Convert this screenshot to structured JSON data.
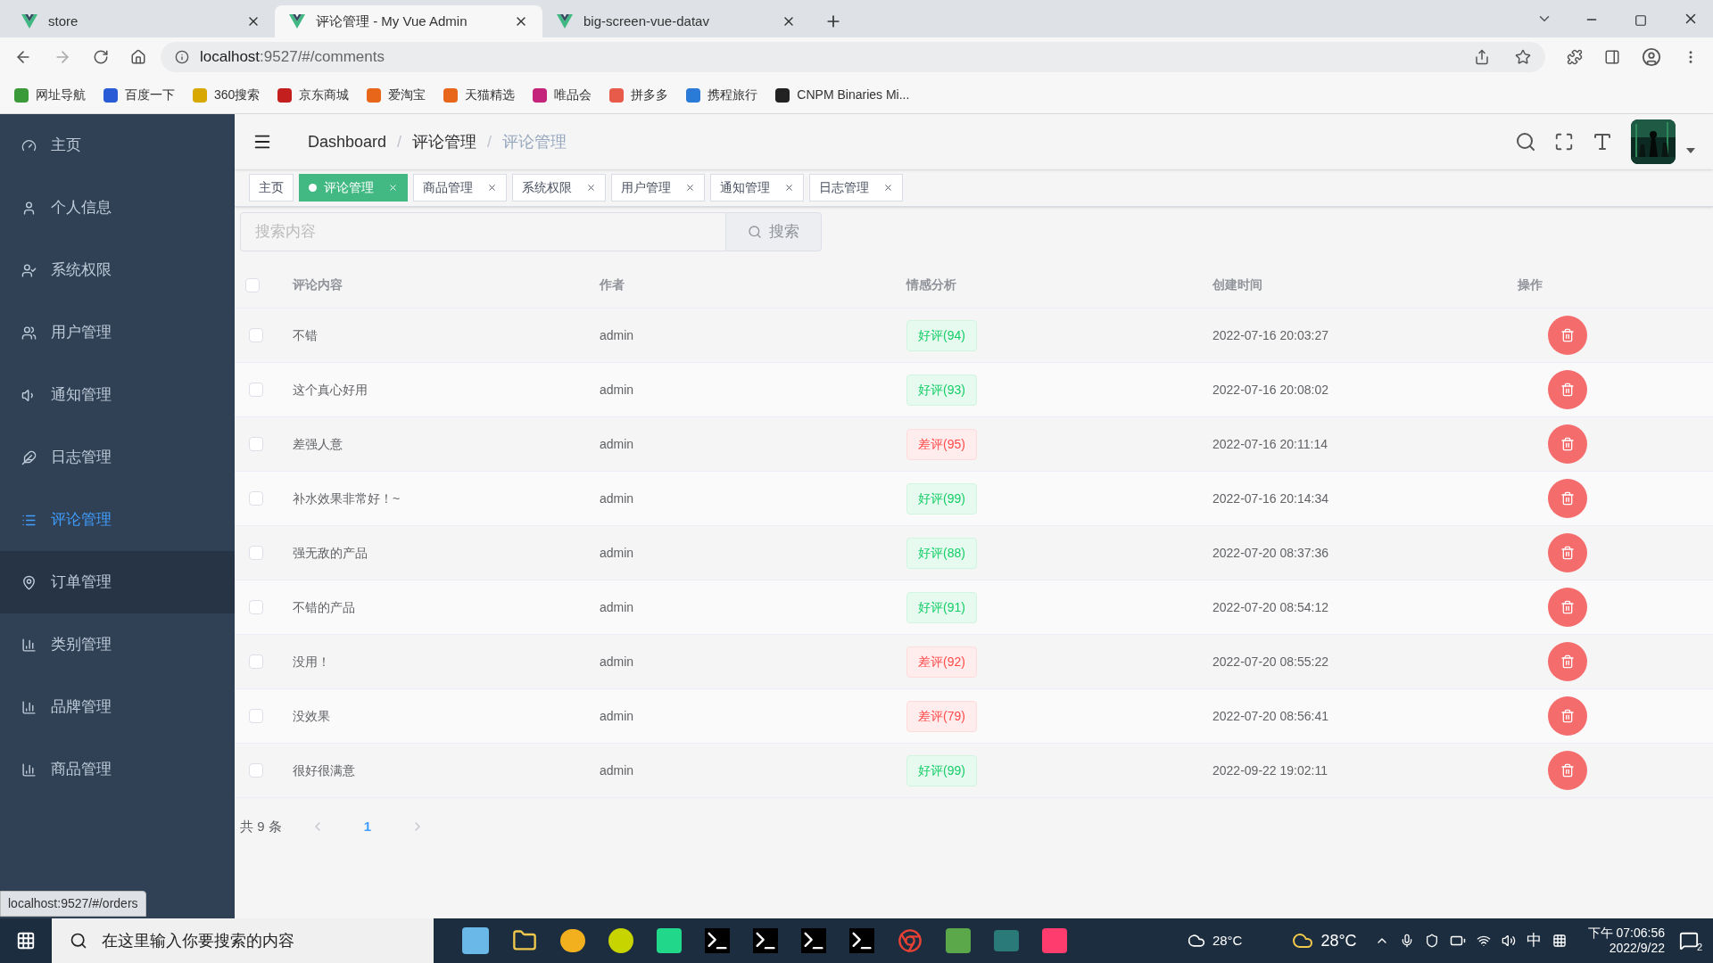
{
  "browser": {
    "tabs": [
      {
        "title": "store",
        "selected": false
      },
      {
        "title": "评论管理 - My Vue Admin",
        "selected": true
      },
      {
        "title": "big-screen-vue-datav",
        "selected": false
      }
    ],
    "url_host": "localhost",
    "url_path": ":9527/#/comments",
    "bookmarks": [
      "网址导航",
      "百度一下",
      "360搜索",
      "京东商城",
      "爱淘宝",
      "天猫精选",
      "唯品会",
      "拼多多",
      "携程旅行",
      "CNPM Binaries Mi..."
    ]
  },
  "sidebar": {
    "items": [
      {
        "label": "主页",
        "selected": false,
        "hovered": false
      },
      {
        "label": "个人信息",
        "selected": false,
        "hovered": false
      },
      {
        "label": "系统权限",
        "selected": false,
        "hovered": false
      },
      {
        "label": "用户管理",
        "selected": false,
        "hovered": false
      },
      {
        "label": "通知管理",
        "selected": false,
        "hovered": false
      },
      {
        "label": "日志管理",
        "selected": false,
        "hovered": false
      },
      {
        "label": "评论管理",
        "selected": true,
        "hovered": false
      },
      {
        "label": "订单管理",
        "selected": false,
        "hovered": true
      },
      {
        "label": "类别管理",
        "selected": false,
        "hovered": false
      },
      {
        "label": "品牌管理",
        "selected": false,
        "hovered": false
      },
      {
        "label": "商品管理",
        "selected": false,
        "hovered": false
      }
    ]
  },
  "breadcrumb": {
    "separator": "/",
    "items": [
      "Dashboard",
      "评论管理",
      "评论管理"
    ]
  },
  "tags": [
    {
      "label": "主页",
      "selected": false,
      "closable": false
    },
    {
      "label": "评论管理",
      "selected": true,
      "closable": true
    },
    {
      "label": "商品管理",
      "selected": false,
      "closable": true
    },
    {
      "label": "系统权限",
      "selected": false,
      "closable": true
    },
    {
      "label": "用户管理",
      "selected": false,
      "closable": true
    },
    {
      "label": "通知管理",
      "selected": false,
      "closable": true
    },
    {
      "label": "日志管理",
      "selected": false,
      "closable": true
    }
  ],
  "search": {
    "placeholder": "搜索内容",
    "button": "搜索"
  },
  "table": {
    "all_checked": false,
    "columns": [
      "评论内容",
      "作者",
      "情感分析",
      "创建时间",
      "操作"
    ],
    "rows": [
      {
        "checked": false,
        "content": "不错",
        "author": "admin",
        "sentiment": "好评(94)",
        "kind": "good",
        "created": "2022-07-16 20:03:27"
      },
      {
        "checked": false,
        "content": "这个真心好用",
        "author": "admin",
        "sentiment": "好评(93)",
        "kind": "good",
        "created": "2022-07-16 20:08:02"
      },
      {
        "checked": false,
        "content": "差强人意",
        "author": "admin",
        "sentiment": "差评(95)",
        "kind": "bad",
        "created": "2022-07-16 20:11:14"
      },
      {
        "checked": false,
        "content": "补水效果非常好！~",
        "author": "admin",
        "sentiment": "好评(99)",
        "kind": "good",
        "created": "2022-07-16 20:14:34"
      },
      {
        "checked": false,
        "content": "强无敌的产品",
        "author": "admin",
        "sentiment": "好评(88)",
        "kind": "good",
        "created": "2022-07-20 08:37:36"
      },
      {
        "checked": false,
        "content": "不错的产品",
        "author": "admin",
        "sentiment": "好评(91)",
        "kind": "good",
        "created": "2022-07-20 08:54:12"
      },
      {
        "checked": false,
        "content": "没用！",
        "author": "admin",
        "sentiment": "差评(92)",
        "kind": "bad",
        "created": "2022-07-20 08:55:22"
      },
      {
        "checked": false,
        "content": "没效果",
        "author": "admin",
        "sentiment": "差评(79)",
        "kind": "bad",
        "created": "2022-07-20 08:56:41"
      },
      {
        "checked": false,
        "content": "很好很满意",
        "author": "admin",
        "sentiment": "好评(99)",
        "kind": "good",
        "created": "2022-09-22 19:02:11"
      }
    ]
  },
  "pagination": {
    "total": "共 9 条",
    "pages": [
      {
        "label": "1",
        "selected": true
      }
    ]
  },
  "status_link": "localhost:9527/#/orders",
  "taskbar": {
    "search_placeholder": "在这里输入你要搜索的内容",
    "weather_left": "28°C",
    "weather_right": "28°C",
    "ime": "中",
    "time": "下午 07:06:56",
    "date": "2022/9/22",
    "notifications": "2"
  }
}
